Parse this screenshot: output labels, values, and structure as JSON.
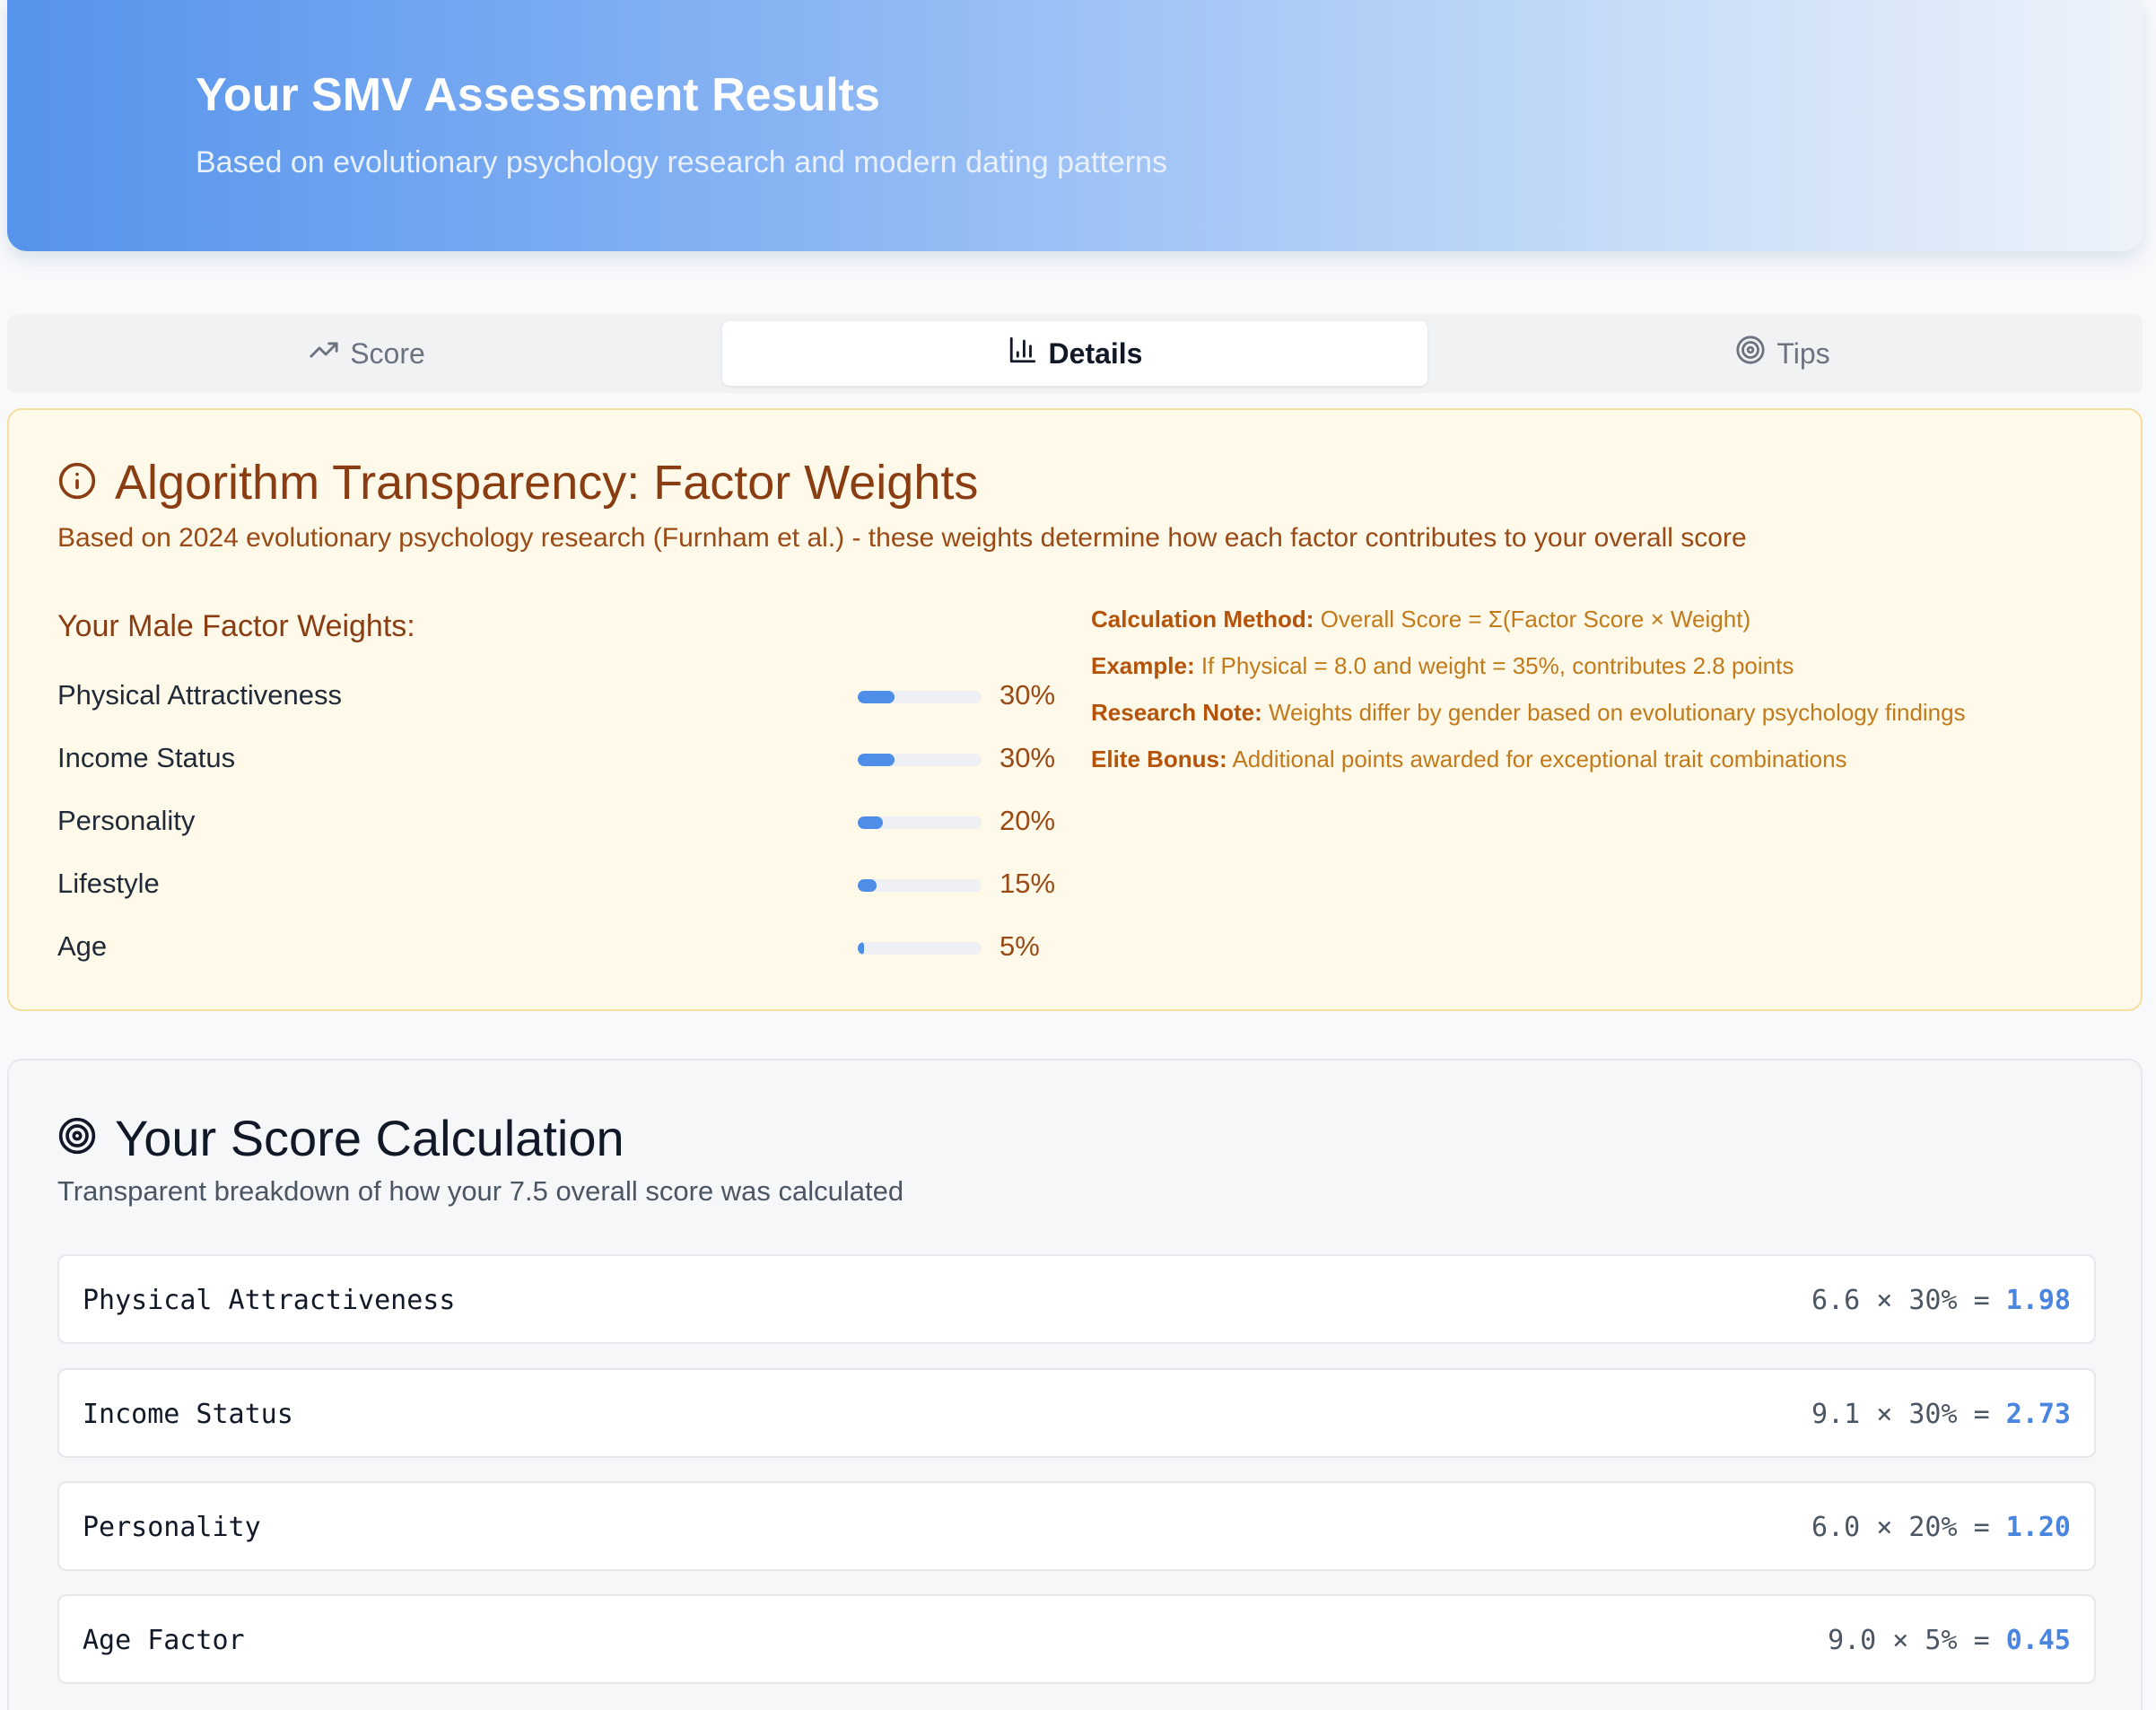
{
  "header": {
    "title": "Your SMV Assessment Results",
    "subtitle": "Based on evolutionary psychology research and modern dating patterns"
  },
  "tabs": [
    {
      "label": "Score",
      "icon": "trending-up-icon",
      "active": false
    },
    {
      "label": "Details",
      "icon": "bar-chart-icon",
      "active": true
    },
    {
      "label": "Tips",
      "icon": "target-icon",
      "active": false
    }
  ],
  "weights_panel": {
    "title": "Algorithm Transparency: Factor Weights",
    "description": "Based on 2024 evolutionary psychology research (Furnham et al.) - these weights determine how each factor contributes to your overall score",
    "subheading": "Your Male Factor Weights:",
    "factors": [
      {
        "label": "Physical Attractiveness",
        "percent": "30%",
        "fraction": 0.3
      },
      {
        "label": "Income Status",
        "percent": "30%",
        "fraction": 0.3
      },
      {
        "label": "Personality",
        "percent": "20%",
        "fraction": 0.2
      },
      {
        "label": "Lifestyle",
        "percent": "15%",
        "fraction": 0.15
      },
      {
        "label": "Age",
        "percent": "5%",
        "fraction": 0.05
      }
    ],
    "notes": [
      {
        "label": "Calculation Method:",
        "text": "Overall Score = Σ(Factor Score × Weight)"
      },
      {
        "label": "Example:",
        "text": "If Physical = 8.0 and weight = 35%, contributes 2.8 points"
      },
      {
        "label": "Research Note:",
        "text": "Weights differ by gender based on evolutionary psychology findings"
      },
      {
        "label": "Elite Bonus:",
        "text": "Additional points awarded for exceptional trait combinations"
      }
    ],
    "colors": {
      "accent": "#8a3d12",
      "bar": "#4f8ee8",
      "background": "#fef9e8"
    }
  },
  "calculation_panel": {
    "title": "Your Score Calculation",
    "description": "Transparent breakdown of how your 7.5 overall score was calculated",
    "rows": [
      {
        "name": "Physical Attractiveness",
        "formula": "6.6 × 30% = ",
        "result": "1.98"
      },
      {
        "name": "Income Status",
        "formula": "9.1 × 30% = ",
        "result": "2.73"
      },
      {
        "name": "Personality",
        "formula": "6.0 × 20% = ",
        "result": "1.20"
      },
      {
        "name": "Age Factor",
        "formula": "9.0 × 5% = ",
        "result": "0.45"
      }
    ]
  }
}
